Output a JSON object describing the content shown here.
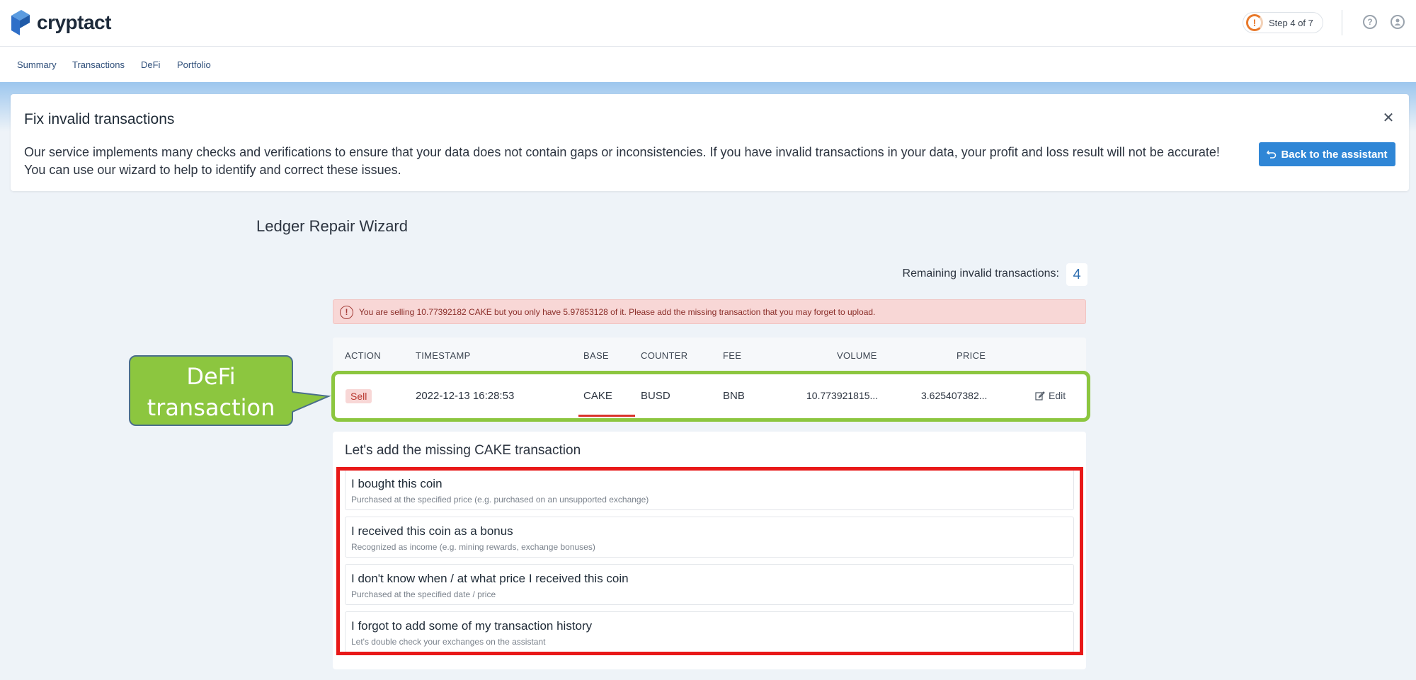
{
  "app": {
    "name": "cryptact"
  },
  "header": {
    "step_text": "Step 4 of 7",
    "step_alert": "!"
  },
  "nav": {
    "items": [
      "Summary",
      "Transactions",
      "DeFi",
      "Portfolio"
    ]
  },
  "fix_card": {
    "title": "Fix invalid transactions",
    "desc_line1": "Our service implements many checks and verifications to ensure that your data does not contain gaps or inconsistencies. If you have invalid transactions in your data, your profit and loss result will not be accurate!",
    "desc_line2": "You can use our wizard to help to identify and correct these issues.",
    "close_glyph": "✕",
    "back_button": "Back to the assistant"
  },
  "wizard": {
    "title": "Ledger Repair Wizard",
    "remaining_label": "Remaining invalid transactions:",
    "remaining_count": "4"
  },
  "alert": {
    "icon": "!",
    "text": "You are selling 10.77392182 CAKE but you only have 5.97853128 of it. Please add the missing transaction that you may forget to upload."
  },
  "table": {
    "headers": [
      "ACTION",
      "TIMESTAMP",
      "BASE",
      "COUNTER",
      "FEE",
      "VOLUME",
      "PRICE"
    ],
    "row": {
      "action": "Sell",
      "timestamp": "2022-12-13 16:28:53",
      "base": "CAKE",
      "counter": "BUSD",
      "fee": "BNB",
      "volume": "10.773921815...",
      "price": "3.625407382...",
      "edit": "Edit"
    }
  },
  "callout": {
    "line1": "DeFi",
    "line2": "transaction"
  },
  "options": {
    "title": "Let's add the missing CAKE transaction",
    "items": [
      {
        "title": "I bought this coin",
        "sub": "Purchased at the specified price (e.g. purchased on an unsupported exchange)"
      },
      {
        "title": "I received this coin as a bonus",
        "sub": "Recognized as income (e.g. mining rewards, exchange bonuses)"
      },
      {
        "title": "I don't know when / at what price I received this coin",
        "sub": "Purchased at the specified date / price"
      },
      {
        "title": "I forgot to add some of my transaction history",
        "sub": "Let's double check your exchanges on the assistant"
      }
    ]
  },
  "colors": {
    "accent": "#2f86d6",
    "highlight_green": "#8cc63f",
    "highlight_red": "#e81818",
    "alert_bg": "#f8d7d6"
  }
}
